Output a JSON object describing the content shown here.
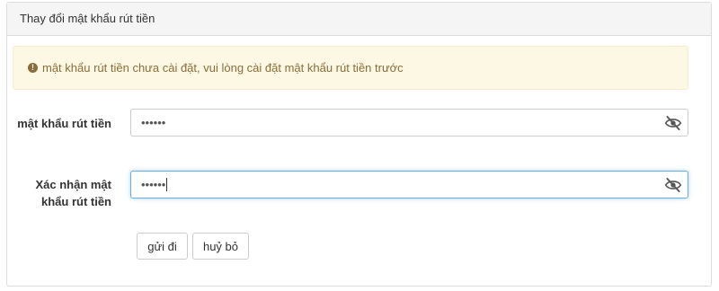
{
  "panel": {
    "title": "Thay đổi mật khẩu rút tiền"
  },
  "alert": {
    "icon": "exclamation-circle-icon",
    "message": "mật khẩu rút tiền chưa cài đặt, vui lòng cài đặt mật khẩu rút tiền trước",
    "color": "#8a6d3b",
    "background": "#fcf8e3"
  },
  "form": {
    "password_label": "mật khẩu rút tiền",
    "password_value": "••••••",
    "confirm_label": "Xác nhận mật khẩu rút tiền",
    "confirm_value": "••••••",
    "toggle_icon": "eye-slash-icon"
  },
  "buttons": {
    "submit": "gửi đi",
    "cancel": "huỷ bỏ"
  }
}
